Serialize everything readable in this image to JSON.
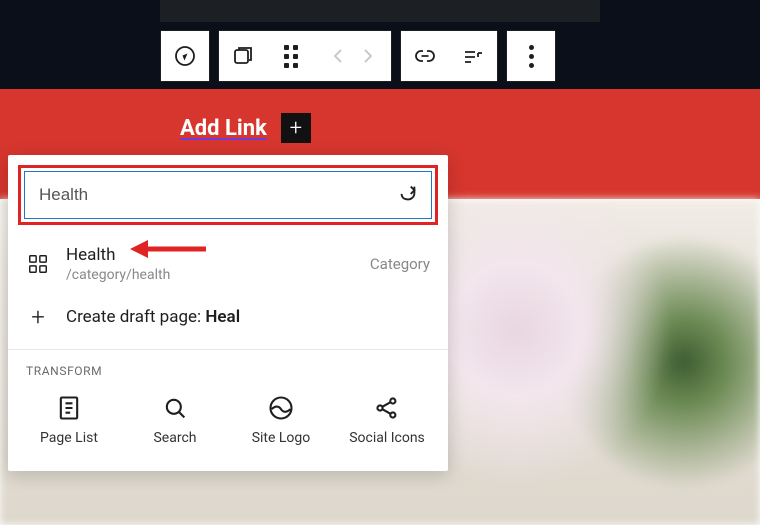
{
  "header": {
    "add_link_label": "Add Link",
    "plus": "+"
  },
  "search": {
    "value": "Health"
  },
  "suggestions": [
    {
      "title": "Health",
      "path": "/category/health",
      "type": "Category"
    }
  ],
  "create_draft": {
    "prefix": "Create draft page:",
    "term": "Heal"
  },
  "transform": {
    "heading": "TRANSFORM",
    "items": [
      {
        "label": "Page List"
      },
      {
        "label": "Search"
      },
      {
        "label": "Site Logo"
      },
      {
        "label": "Social Icons"
      }
    ]
  }
}
